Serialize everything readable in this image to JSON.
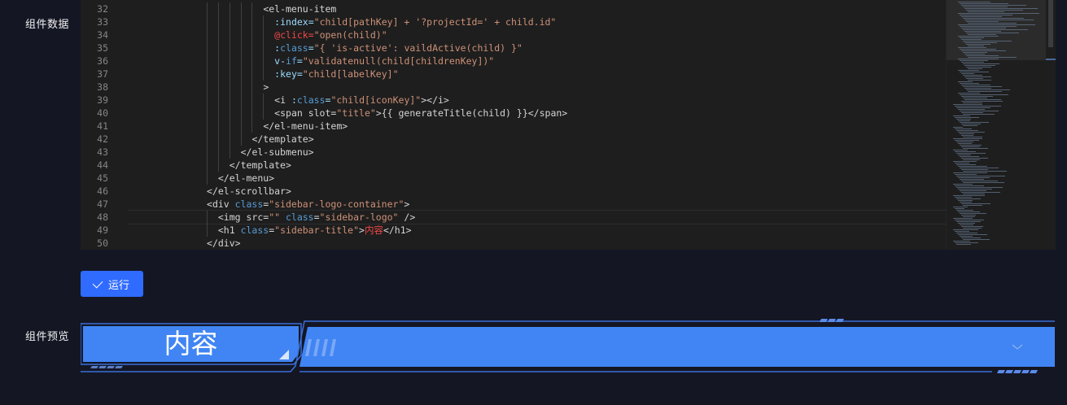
{
  "labels": {
    "component_data": "组件数据",
    "component_preview": "组件预览"
  },
  "editor": {
    "lines": [
      {
        "n": "32",
        "indent": 12,
        "segs": [
          [
            "tag",
            "<el-menu-item"
          ]
        ]
      },
      {
        "n": "33",
        "indent": 13,
        "segs": [
          [
            "attr",
            ":index="
          ],
          [
            "str",
            "\"child[pathKey] + '?projectId=' + child.id\""
          ]
        ]
      },
      {
        "n": "34",
        "indent": 13,
        "segs": [
          [
            "evt",
            "@click="
          ],
          [
            "str",
            "\"open(child)\""
          ]
        ]
      },
      {
        "n": "35",
        "indent": 13,
        "segs": [
          [
            "attr",
            ":"
          ],
          [
            "kw",
            "class"
          ],
          [
            "attr",
            "="
          ],
          [
            "str",
            "\"{ 'is-active': vaildActive(child) }\""
          ]
        ]
      },
      {
        "n": "36",
        "indent": 13,
        "segs": [
          [
            "attr",
            "v-"
          ],
          [
            "kw",
            "if"
          ],
          [
            "attr",
            "="
          ],
          [
            "str",
            "\"validatenull(child[childrenKey])\""
          ]
        ]
      },
      {
        "n": "37",
        "indent": 13,
        "segs": [
          [
            "attr",
            ":key="
          ],
          [
            "str",
            "\"child[labelKey]\""
          ]
        ]
      },
      {
        "n": "38",
        "indent": 12,
        "segs": [
          [
            "tag",
            ">"
          ]
        ]
      },
      {
        "n": "39",
        "indent": 13,
        "segs": [
          [
            "tag",
            "<i "
          ],
          [
            "attr",
            ":"
          ],
          [
            "kw",
            "class"
          ],
          [
            "attr",
            "="
          ],
          [
            "str",
            "\"child[iconKey]\""
          ],
          [
            "tag",
            "></i>"
          ]
        ]
      },
      {
        "n": "40",
        "indent": 13,
        "segs": [
          [
            "tag",
            "<span slot="
          ],
          [
            "str",
            "\"title\""
          ],
          [
            "tag",
            ">{{ generateTitle(child) }}</span>"
          ]
        ]
      },
      {
        "n": "41",
        "indent": 12,
        "segs": [
          [
            "tag",
            "</el-menu-item>"
          ]
        ]
      },
      {
        "n": "42",
        "indent": 11,
        "segs": [
          [
            "tag",
            "</template>"
          ]
        ]
      },
      {
        "n": "43",
        "indent": 10,
        "segs": [
          [
            "tag",
            "</el-submenu>"
          ]
        ]
      },
      {
        "n": "44",
        "indent": 9,
        "segs": [
          [
            "tag",
            "</template>"
          ]
        ]
      },
      {
        "n": "45",
        "indent": 8,
        "segs": [
          [
            "tag",
            "</el-menu>"
          ]
        ]
      },
      {
        "n": "46",
        "indent": 7,
        "segs": [
          [
            "tag",
            "</el-scrollbar>"
          ]
        ]
      },
      {
        "n": "47",
        "indent": 7,
        "segs": [
          [
            "tag",
            "<div "
          ],
          [
            "kw",
            "class"
          ],
          [
            "tag",
            "="
          ],
          [
            "str",
            "\"sidebar-logo-container\""
          ],
          [
            "tag",
            ">"
          ]
        ]
      },
      {
        "n": "48",
        "indent": 8,
        "segs": [
          [
            "tag",
            "<img src="
          ],
          [
            "str",
            "\"\""
          ],
          [
            "tag",
            " "
          ],
          [
            "kw",
            "class"
          ],
          [
            "tag",
            "="
          ],
          [
            "str",
            "\"sidebar-logo\""
          ],
          [
            "tag",
            " />"
          ]
        ]
      },
      {
        "n": "49",
        "indent": 8,
        "segs": [
          [
            "tag",
            "<h1 "
          ],
          [
            "kw",
            "class"
          ],
          [
            "tag",
            "="
          ],
          [
            "str",
            "\"sidebar-title\""
          ],
          [
            "tag",
            ">"
          ],
          [
            "cn",
            "内容"
          ],
          [
            "tag",
            "</h1>"
          ]
        ]
      },
      {
        "n": "50",
        "indent": 7,
        "segs": [
          [
            "tag",
            "</div>"
          ]
        ]
      }
    ],
    "current_line": "48"
  },
  "run_button": {
    "label": "运行",
    "icon": "check-icon"
  },
  "preview": {
    "title": "内容",
    "dropdown_icon": "chevron-down-icon"
  },
  "colors": {
    "background": "#141624",
    "accent": "#2f6bff",
    "preview_fill": "#4085f3",
    "preview_border": "#3a6fd8"
  }
}
